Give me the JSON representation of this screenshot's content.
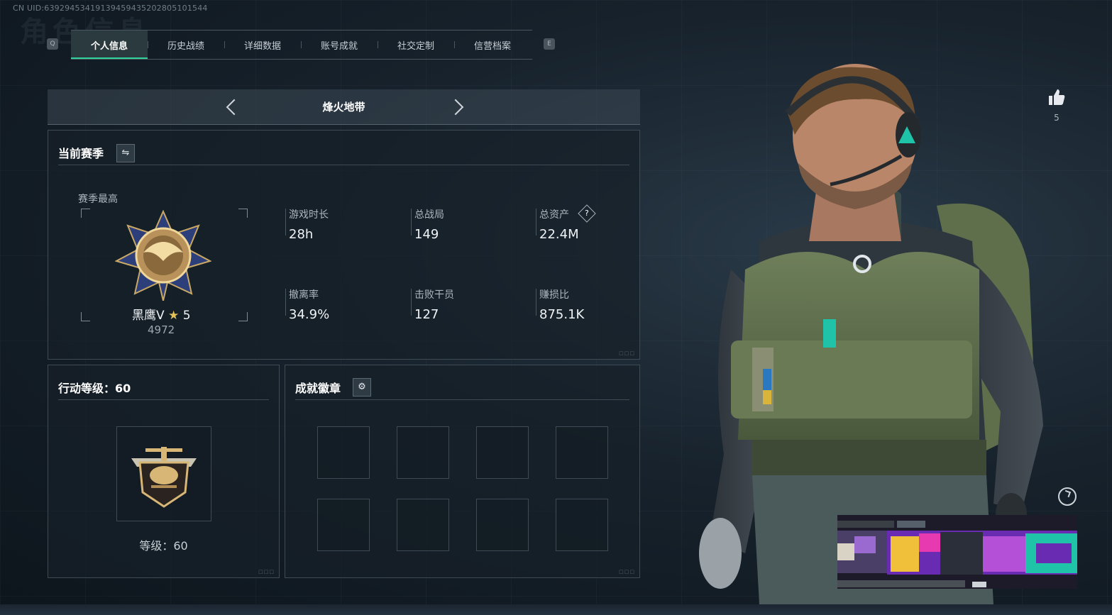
{
  "uid_text": "CN UID:6392945341913945943520​2805101544",
  "ghost_title": "角色信息",
  "key_hints": {
    "left": "Q",
    "right": "E"
  },
  "tabs": [
    {
      "label": "个人信息",
      "active": true
    },
    {
      "label": "历史战绩",
      "active": false
    },
    {
      "label": "详细数据",
      "active": false
    },
    {
      "label": "账号成就",
      "active": false
    },
    {
      "label": "社交定制",
      "active": false
    },
    {
      "label": "信营档案",
      "active": false
    }
  ],
  "mode_selector": {
    "title": "烽火地带"
  },
  "season_panel": {
    "title": "当前赛季",
    "season_high_label": "赛季最高",
    "rank_name": "黑鹰V",
    "rank_stars": "5",
    "rank_points": "4972",
    "stats": [
      {
        "label": "游戏时长",
        "value": "28h"
      },
      {
        "label": "总战局",
        "value": "149"
      },
      {
        "label": "总资产",
        "value": "22.4M",
        "help": "?"
      },
      {
        "label": "撤离率",
        "value": "34.9%"
      },
      {
        "label": "击败干员",
        "value": "127"
      },
      {
        "label": "赚损比",
        "value": "875.1K"
      }
    ]
  },
  "level_panel": {
    "title": "行动等级：60",
    "level_text": "等级：60"
  },
  "achievement_panel": {
    "title": "成就徽章"
  },
  "likes": {
    "count": "5"
  },
  "colors": {
    "accent_green": "#2fd29a",
    "background": "#17222c",
    "panel_border": "#3e4a54"
  }
}
